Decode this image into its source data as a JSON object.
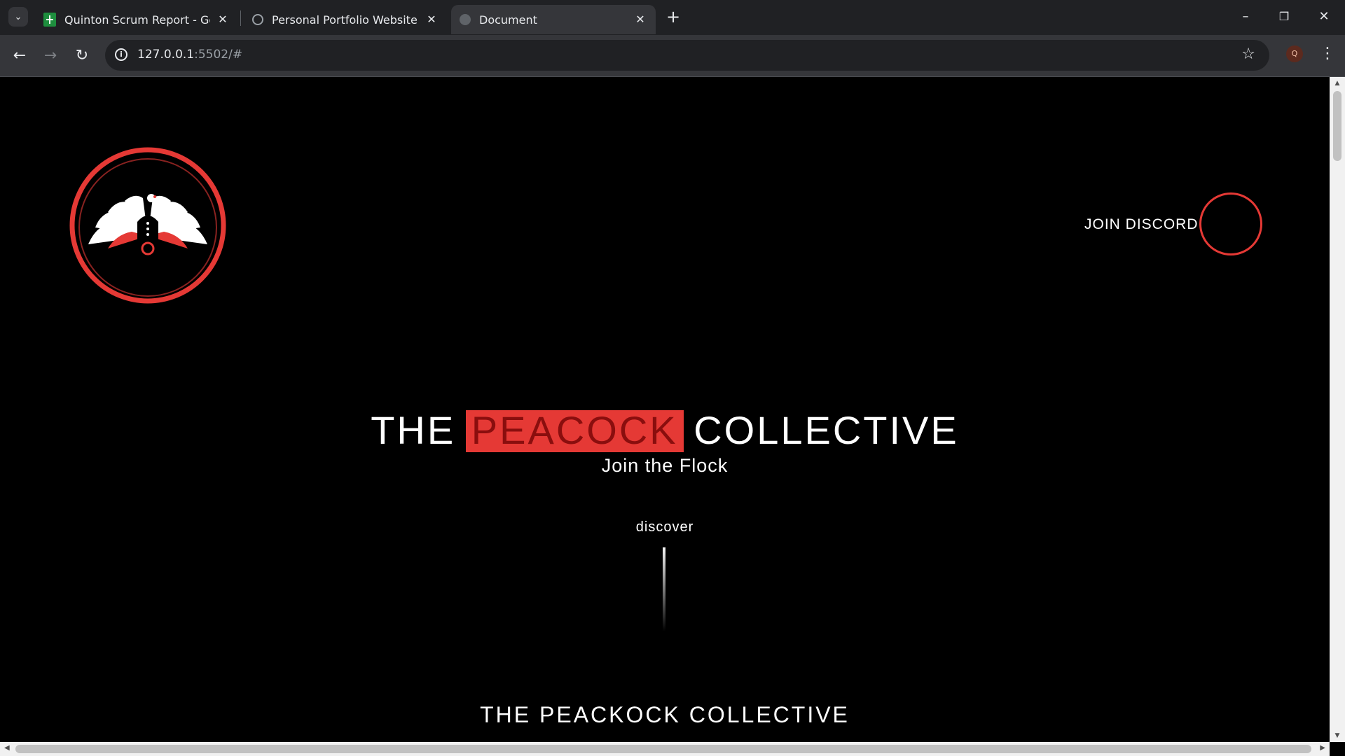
{
  "browser": {
    "tabs": [
      {
        "title": "Quinton Scrum Report - Google Sheets",
        "favicon": "sheets-icon"
      },
      {
        "title": "Personal Portfolio Website",
        "favicon": "globe-icon"
      },
      {
        "title": "Document",
        "favicon": "document-icon",
        "active": true
      }
    ],
    "url_host": "127.0.0.1",
    "url_rest": ":5502/#",
    "avatar_initial": "Q"
  },
  "site": {
    "discord_label": "JOIN DISCORD",
    "title_left": "THE",
    "title_mid": "PEACOCK",
    "title_right": "COLLECTIVE",
    "tagline": "Join the Flock",
    "discover": "discover",
    "footer_title": "THE PEACKOCK COLLECTIVE"
  },
  "colors": {
    "accent": "#e53935",
    "background": "#000000",
    "text": "#ffffff"
  }
}
